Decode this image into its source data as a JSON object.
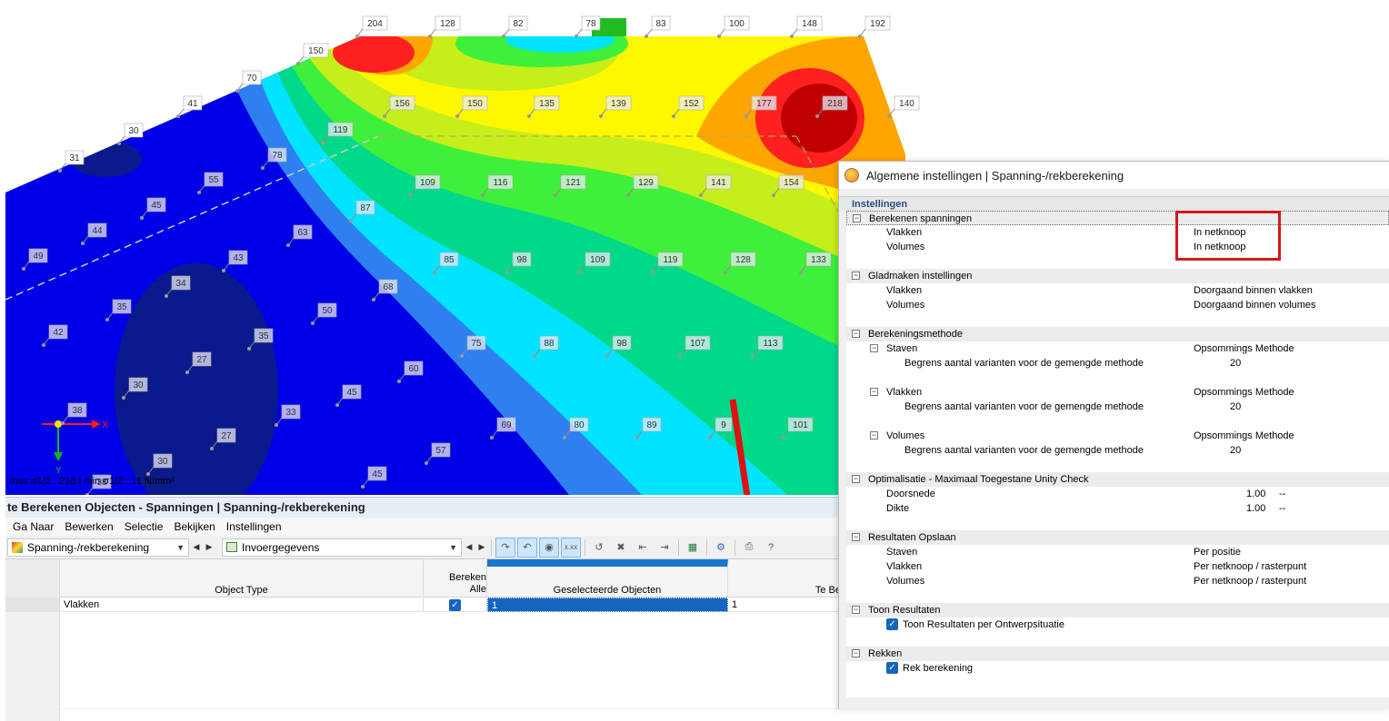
{
  "viewport": {
    "top_labels": [
      "204",
      "128",
      "82",
      "78",
      "83",
      "100",
      "148",
      "192"
    ],
    "edge_labels": [
      "150",
      "70",
      "41",
      "30",
      "31",
      "140"
    ],
    "point_labels": [
      "156",
      "150",
      "135",
      "139",
      "152",
      "177",
      "218",
      "119",
      "78",
      "55",
      "45",
      "44",
      "49",
      "109",
      "116",
      "121",
      "129",
      "141",
      "154",
      "87",
      "63",
      "43",
      "34",
      "35",
      "42",
      "85",
      "98",
      "109",
      "119",
      "128",
      "133",
      "68",
      "50",
      "35",
      "27",
      "30",
      "38",
      "33",
      "27",
      "30",
      "38",
      "75",
      "88",
      "98",
      "107",
      "113",
      "60",
      "45",
      "69",
      "80",
      "89",
      "9",
      "101",
      "57",
      "45"
    ],
    "legend_text": "max σ1/2 : 218 | min σ1/2 : 11 N/mm²",
    "axis_x": "X",
    "axis_y": "Y",
    "colors": {
      "dark_blue": "#0a1a8c",
      "blue": "#0000e6",
      "light_blue": "#2e7ff0",
      "cyan": "#00e4ff",
      "teal": "#00d88a",
      "green": "#3ef03a",
      "yellow_green": "#c6ee1a",
      "yellow": "#fff700",
      "orange": "#ffa500",
      "red": "#ff2020",
      "dark_red": "#c00000",
      "arrow_red": "#e01010"
    }
  },
  "bottom_panel": {
    "title": "te Berekenen Objecten - Spanningen | Spanning-/rekberekening",
    "menu": [
      "Ga Naar",
      "Bewerken",
      "Selectie",
      "Bekijken",
      "Instellingen"
    ],
    "combo1": "Spanning-/rekberekening",
    "combo2": "Invoergegevens",
    "columns": {
      "object_type": "Object Type",
      "bereken_alle_1": "Bereken",
      "bereken_alle_2": "Alle",
      "geselecteerde": "Geselecteerde Objecten",
      "te_be": "Te Be"
    },
    "rows": [
      {
        "object_type": "Vlakken",
        "geselecteerde": "1",
        "te_be": "1"
      }
    ]
  },
  "dialog": {
    "title": "Algemene instellingen | Spanning-/rekberekening",
    "section": "Instellingen",
    "groups": {
      "berekenen_spanningen": "Berekenen spanningen",
      "vlakken": "Vlakken",
      "volumes": "Volumes",
      "in_netknoop_1": "In netknoop",
      "in_netknoop_2": "In netknoop",
      "gladmaken": "Gladmaken instellingen",
      "doorgaand_vlakken": "Doorgaand binnen vlakken",
      "doorgaand_volumes": "Doorgaand binnen volumes",
      "berekeningsmethode": "Berekeningsmethode",
      "staven": "Staven",
      "opsommings": "Opsommings Methode",
      "begrens": "Begrens aantal varianten voor de gemengde methode",
      "twenty": "20",
      "optimalisatie": "Optimalisatie - Maximaal Toegestane Unity Check",
      "doorsnede": "Doorsnede",
      "dikte": "Dikte",
      "one": "1.00",
      "dashes": "--",
      "resultaten_opslaan": "Resultaten Opslaan",
      "per_positie": "Per positie",
      "per_netknoop": "Per netknoop / rasterpunt",
      "toon_resultaten": "Toon Resultaten",
      "toon_per_ontwerp": "Toon Resultaten per Ontwerpsituatie",
      "rekken": "Rekken",
      "rek_berekening": "Rek berekening"
    }
  }
}
